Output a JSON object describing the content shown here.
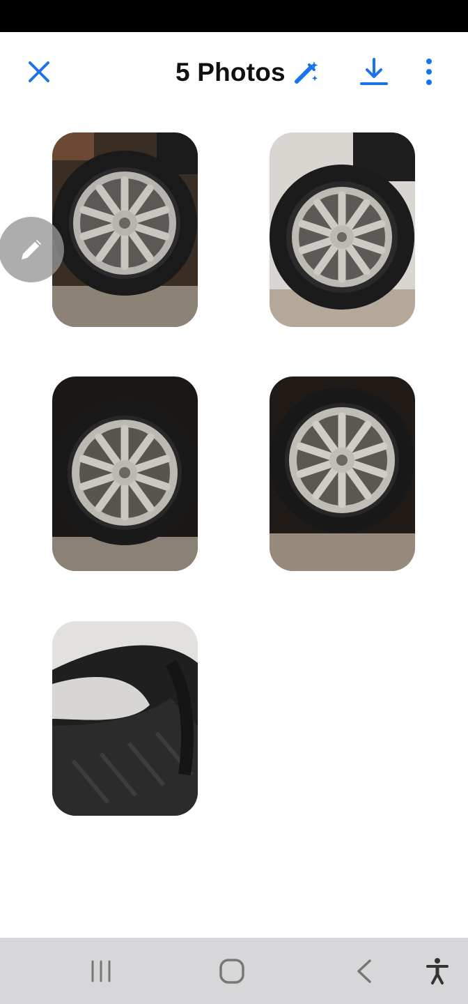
{
  "header": {
    "title": "5 Photos",
    "close_icon": "close-icon",
    "ai_edit_icon": "magic-pen-icon",
    "download_icon": "download-icon",
    "more_icon": "more-vertical-icon",
    "accent_color": "#1a73e8"
  },
  "photos": [
    {
      "subject": "tire-alloy-wheel"
    },
    {
      "subject": "tire-alloy-wheel"
    },
    {
      "subject": "tire-alloy-wheel"
    },
    {
      "subject": "tire-alloy-wheel"
    },
    {
      "subject": "tire-tread-closeup"
    }
  ],
  "edit_fab": {
    "icon": "pencil-icon"
  },
  "system_nav": {
    "recents_icon": "recents-icon",
    "home_icon": "home-icon",
    "back_icon": "back-icon",
    "accessibility_icon": "accessibility-icon"
  }
}
